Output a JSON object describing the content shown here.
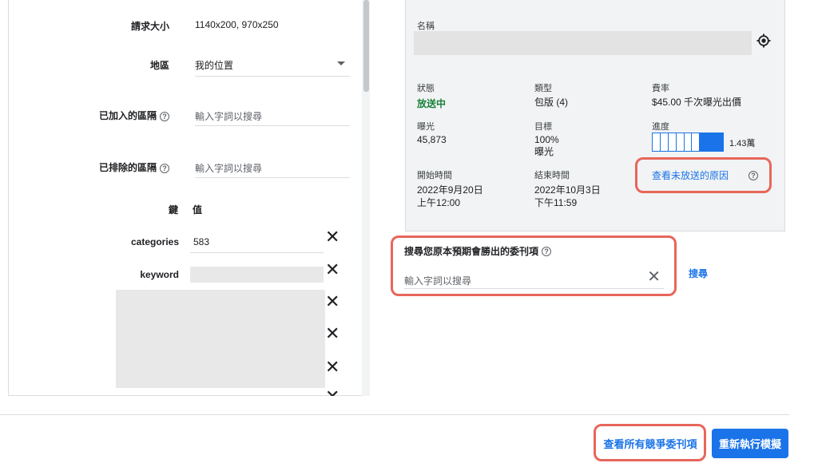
{
  "left": {
    "fields": {
      "request_size_label": "請求大小",
      "request_size_value": "1140x200, 970x250",
      "region_label": "地區",
      "region_value": "我的位置",
      "included_segments_label": "已加入的區隔",
      "included_segments_placeholder": "輸入字詞以搜尋",
      "excluded_segments_label": "已排除的區隔",
      "excluded_segments_placeholder": "輸入字詞以搜尋"
    },
    "kv": {
      "key_header": "鍵",
      "value_header": "值",
      "rows": [
        {
          "key": "categories",
          "value": "583"
        },
        {
          "key": "keyword",
          "value": ""
        }
      ]
    },
    "close_symbol": "✕"
  },
  "card": {
    "name_label": "名稱",
    "status_label": "狀態",
    "status_value": "放送中",
    "type_label": "類型",
    "type_value": "包版 (4)",
    "rate_label": "費率",
    "rate_value": "$45.00 千次曝光出價",
    "impressions_label": "曝光",
    "impressions_value": "45,873",
    "goal_label": "目標",
    "goal_value_line1": "100%",
    "goal_value_line2": "曝光",
    "progress_label": "進度",
    "progress_value": "1.43萬",
    "progress_fraction": 0.78,
    "why_not_delivering": "查看未放送的原因",
    "start_label": "開始時間",
    "start_value_line1": "2022年9月20日",
    "start_value_line2": "上午12:00",
    "end_label": "結束時間",
    "end_value_line1": "2022年10月3日",
    "end_value_line2": "下午11:59"
  },
  "search": {
    "title": "搜尋您原本預期會勝出的委刊項",
    "placeholder": "輸入字詞以搜尋",
    "button": "搜尋"
  },
  "footer": {
    "view_all": "查看所有競爭委刊項",
    "rerun": "重新執行模擬"
  },
  "colors": {
    "accent": "#1a73e8",
    "highlight": "#e8665a",
    "status_green": "#188038"
  }
}
